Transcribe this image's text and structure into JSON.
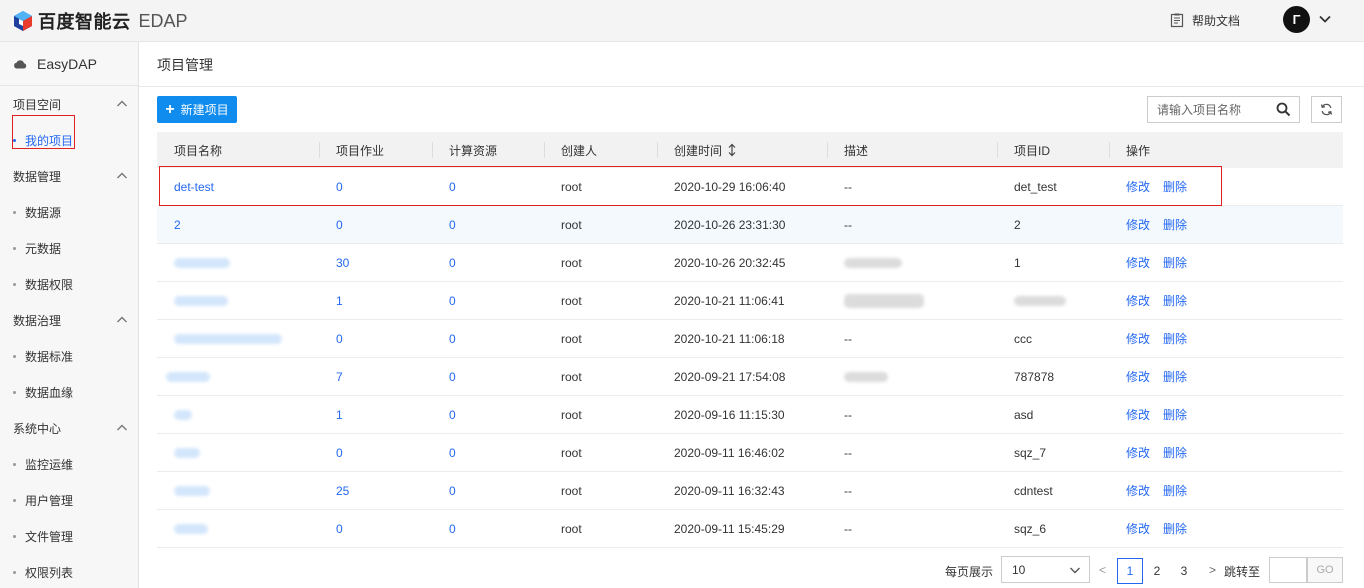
{
  "header": {
    "logo_text": "百度智能云",
    "product": "EDAP",
    "help_label": "帮助文档",
    "user_initial": "Γ"
  },
  "sidebar": {
    "brand": "EasyDAP",
    "groups": [
      {
        "label": "项目空间",
        "items": [
          {
            "label": "我的项目",
            "active": true
          }
        ]
      },
      {
        "label": "数据管理",
        "items": [
          {
            "label": "数据源"
          },
          {
            "label": "元数据"
          },
          {
            "label": "数据权限"
          }
        ]
      },
      {
        "label": "数据治理",
        "items": [
          {
            "label": "数据标准"
          },
          {
            "label": "数据血缘"
          }
        ]
      },
      {
        "label": "系统中心",
        "items": [
          {
            "label": "监控运维"
          },
          {
            "label": "用户管理"
          },
          {
            "label": "文件管理"
          },
          {
            "label": "权限列表"
          }
        ]
      }
    ]
  },
  "main": {
    "title": "项目管理",
    "new_button": "新建项目",
    "search_placeholder": "请输入项目名称"
  },
  "table": {
    "columns": [
      "项目名称",
      "项目作业",
      "计算资源",
      "创建人",
      "创建时间",
      "描述",
      "项目ID",
      "操作"
    ],
    "ops": [
      "修改",
      "删除"
    ],
    "rows": [
      {
        "name": "det-test",
        "jobs": "0",
        "resources": "0",
        "creator": "root",
        "created": "2020-10-29 16:06:40",
        "desc": "--",
        "id": "det_test"
      },
      {
        "name": "2",
        "jobs": "0",
        "resources": "0",
        "creator": "root",
        "created": "2020-10-26 23:31:30",
        "desc": "--",
        "id": "2"
      },
      {
        "name": "",
        "jobs": "30",
        "resources": "0",
        "creator": "root",
        "created": "2020-10-26 20:32:45",
        "desc": "",
        "id": "1"
      },
      {
        "name": "",
        "jobs": "1",
        "resources": "0",
        "creator": "root",
        "created": "2020-10-21 11:06:41",
        "desc": "",
        "id": ""
      },
      {
        "name": "",
        "jobs": "0",
        "resources": "0",
        "creator": "root",
        "created": "2020-10-21 11:06:18",
        "desc": "--",
        "id": "ccc"
      },
      {
        "name": "",
        "jobs": "7",
        "resources": "0",
        "creator": "root",
        "created": "2020-09-21 17:54:08",
        "desc": "",
        "id": "787878"
      },
      {
        "name": "",
        "jobs": "1",
        "resources": "0",
        "creator": "root",
        "created": "2020-09-16 11:15:30",
        "desc": "--",
        "id": "asd"
      },
      {
        "name": "",
        "jobs": "0",
        "resources": "0",
        "creator": "root",
        "created": "2020-09-11 16:46:02",
        "desc": "--",
        "id": "sqz_7"
      },
      {
        "name": "",
        "jobs": "25",
        "resources": "0",
        "creator": "root",
        "created": "2020-09-11 16:32:43",
        "desc": "--",
        "id": "cdntest"
      },
      {
        "name": "",
        "jobs": "0",
        "resources": "0",
        "creator": "root",
        "created": "2020-09-11 15:45:29",
        "desc": "--",
        "id": "sqz_6"
      }
    ]
  },
  "pagination": {
    "per_page_label": "每页展示",
    "per_page_value": "10",
    "prev": "<",
    "pages": [
      "1",
      "2",
      "3"
    ],
    "current": "1",
    "next": ">",
    "jump_label": "跳转至",
    "go_label": "GO"
  }
}
